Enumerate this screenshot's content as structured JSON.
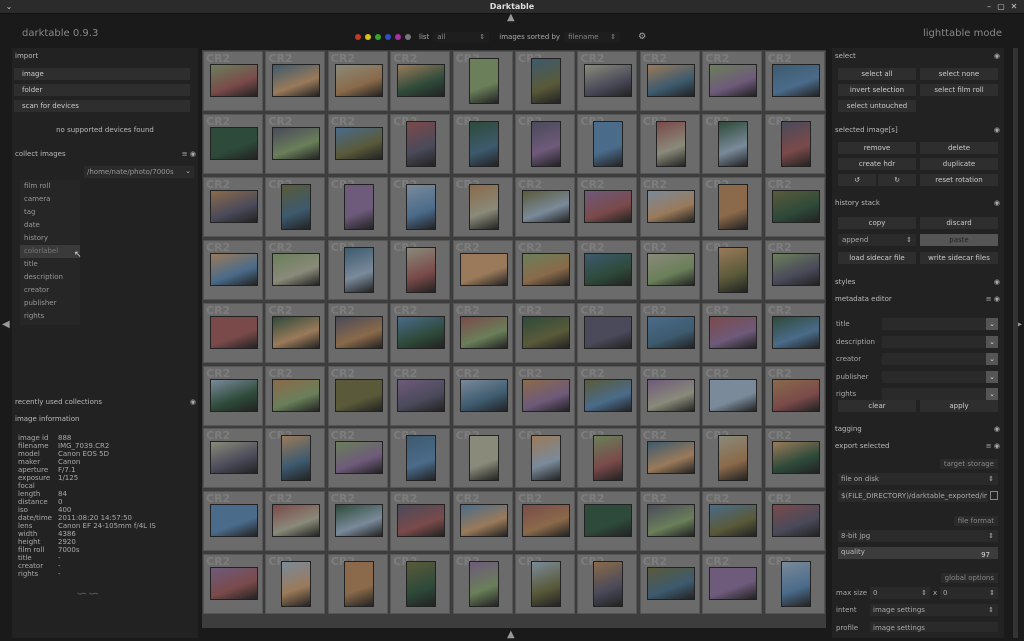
{
  "window": {
    "title": "Darktable"
  },
  "brand": "darktable 0.9.3",
  "mode": "lighttable mode",
  "topbar": {
    "colors": [
      "#c0392b",
      "#d4c21a",
      "#2fa82f",
      "#2d4fc0",
      "#a82fa8",
      "#777777"
    ],
    "view_label": "list",
    "filter_value": "all",
    "sort_label": "images sorted by",
    "sort_value": "filename"
  },
  "left": {
    "import": {
      "title": "import",
      "buttons": [
        "image",
        "folder",
        "scan for devices"
      ],
      "note": "no supported devices found"
    },
    "collect": {
      "title": "collect images",
      "selected": "film roll",
      "path": "/home/nate/photo/7000s",
      "menu": [
        "film roll",
        "camera",
        "tag",
        "date",
        "history",
        "colorlabel",
        "title",
        "description",
        "creator",
        "publisher",
        "rights"
      ]
    },
    "recent": {
      "title": "recently used collections"
    },
    "info": {
      "title": "image information",
      "rows": [
        [
          "image id",
          "888"
        ],
        [
          "filename",
          "IMG_7039.CR2"
        ],
        [
          "model",
          "Canon EOS 5D"
        ],
        [
          "maker",
          "Canon"
        ],
        [
          "aperture",
          "F/7.1"
        ],
        [
          "exposure",
          "1/125"
        ],
        [
          "focal length",
          "84"
        ],
        [
          "distance",
          "0"
        ],
        [
          "iso",
          "400"
        ],
        [
          "date/time",
          "2011:08:20 14:57:50"
        ],
        [
          "lens",
          "Canon EF 24-105mm f/4L IS"
        ],
        [
          "width",
          "4386"
        ],
        [
          "height",
          "2920"
        ],
        [
          "film roll",
          "7000s"
        ],
        [
          "title",
          "-"
        ],
        [
          "creator",
          "-"
        ],
        [
          "rights",
          "-"
        ]
      ]
    }
  },
  "grid": {
    "label": "CR2",
    "rows": 9,
    "cols": 10
  },
  "right": {
    "select": {
      "title": "select",
      "buttons": [
        "select all",
        "select none",
        "invert selection",
        "select film roll",
        "select untouched"
      ]
    },
    "selected": {
      "title": "selected image[s]",
      "buttons": [
        "remove",
        "delete",
        "create hdr",
        "duplicate",
        "reset rotation"
      ]
    },
    "history": {
      "title": "history stack",
      "buttons": [
        "copy",
        "discard",
        "paste",
        "load sidecar file",
        "write sidecar files"
      ],
      "mode": "append"
    },
    "styles": {
      "title": "styles"
    },
    "metadata": {
      "title": "metadata editor",
      "fields": [
        "title",
        "description",
        "creator",
        "publisher",
        "rights"
      ],
      "clear": "clear",
      "apply": "apply"
    },
    "tagging": {
      "title": "tagging"
    },
    "export": {
      "title": "export selected",
      "storage_head": "target storage",
      "storage": "file on disk",
      "path": "$(FILE_DIRECTORY)/darktable_exported/im",
      "format_head": "file format",
      "format": "8-bit jpg",
      "quality_label": "quality",
      "quality": "97",
      "global_head": "global options",
      "max_size_label": "max size",
      "max_w": "0",
      "max_x": "x",
      "max_h": "0",
      "intent_label": "intent",
      "intent": "image settings",
      "profile_label": "profile",
      "profile": "image settings"
    }
  }
}
